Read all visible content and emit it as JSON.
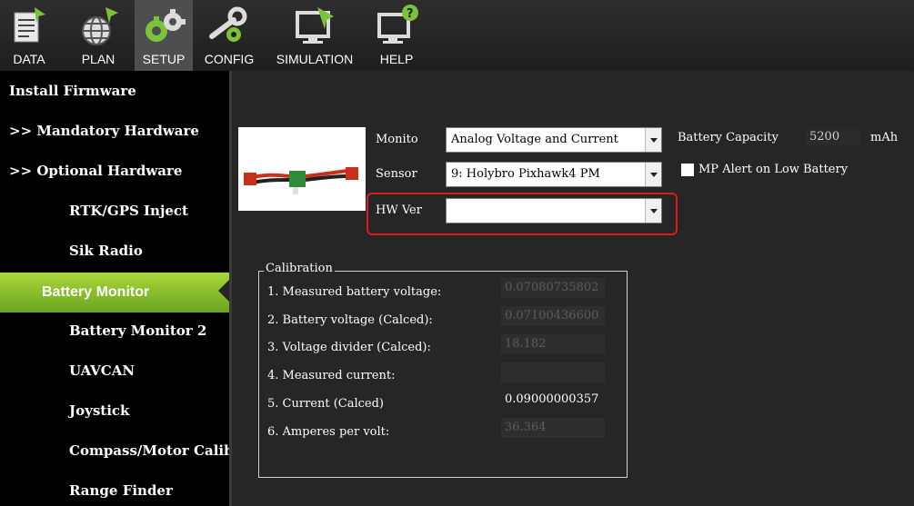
{
  "toolbar": {
    "items": [
      {
        "label": "DATA",
        "icon": "data-icon"
      },
      {
        "label": "PLAN",
        "icon": "globe-icon"
      },
      {
        "label": "SETUP",
        "icon": "gears-icon"
      },
      {
        "label": "CONFIG",
        "icon": "wrench-icon"
      },
      {
        "label": "SIMULATION",
        "icon": "monitor-plane-icon"
      },
      {
        "label": "HELP",
        "icon": "monitor-question-icon"
      }
    ]
  },
  "sidebar": {
    "items": [
      {
        "label": "Install Firmware"
      },
      {
        "label": ">> Mandatory Hardware"
      },
      {
        "label": ">> Optional Hardware"
      },
      {
        "label": "RTK/GPS Inject"
      },
      {
        "label": "Sik Radio"
      },
      {
        "label": "Battery Monitor"
      },
      {
        "label": "Battery Monitor 2"
      },
      {
        "label": "UAVCAN"
      },
      {
        "label": "Joystick"
      },
      {
        "label": "Compass/Motor Calib"
      },
      {
        "label": "Range Finder"
      }
    ]
  },
  "battery": {
    "monitor_label": "Monito",
    "monitor_value": "Analog Voltage and Current",
    "sensor_label": "Sensor",
    "sensor_value": "9: Holybro Pixhawk4 PM",
    "hwver_label": "HW Ver",
    "hwver_value": "",
    "capacity_label": "Battery Capacity",
    "capacity_value": "5200",
    "capacity_unit": "mAh",
    "mp_alert_label": "MP Alert on Low Battery"
  },
  "calibration": {
    "title": "Calibration",
    "rows": [
      {
        "label": "1. Measured battery voltage:",
        "value": "0.07080735802"
      },
      {
        "label": "2. Battery voltage (Calced):",
        "value": "0.07100436600"
      },
      {
        "label": "3. Voltage divider (Calced):",
        "value": "18.182"
      },
      {
        "label": "4. Measured current:",
        "value": ""
      },
      {
        "label": "5. Current (Calced)",
        "value": "0.09000000357"
      },
      {
        "label": "6. Amperes per volt:",
        "value": "36.364"
      }
    ]
  },
  "colors": {
    "active_item": "#8cc43a",
    "highlight": "#e0191f"
  }
}
